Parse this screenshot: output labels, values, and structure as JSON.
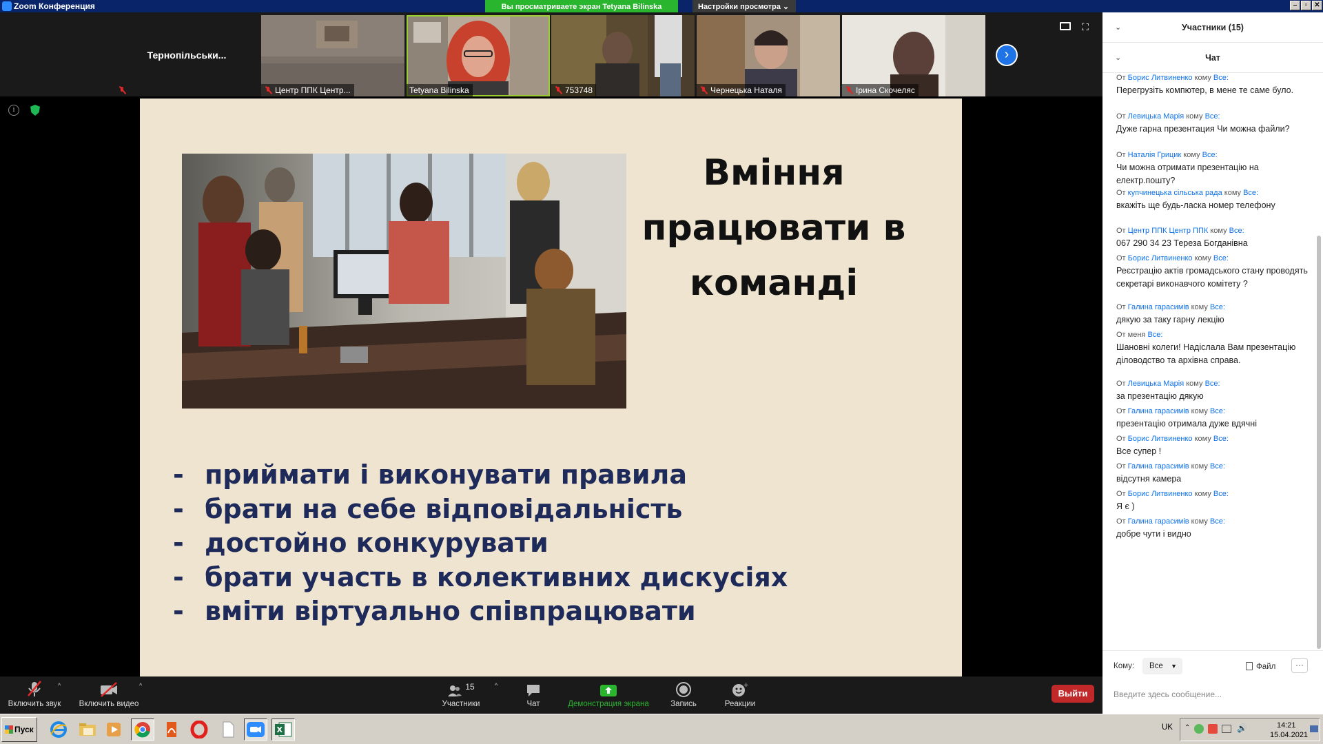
{
  "window": {
    "title": "Zoom Конференция",
    "share_banner": "Вы просматриваете экран Tetyana Bilinska",
    "view_options": "Настройки просмотра ⌄"
  },
  "gallery": {
    "tiles": [
      {
        "name": "Тернопільськи...",
        "muted": true,
        "video": false
      },
      {
        "name": "Центр ППК Центр...",
        "muted": true,
        "video": true
      },
      {
        "name": "Tetyana Bilinska",
        "muted": false,
        "video": true,
        "active_speaker": true
      },
      {
        "name": "753748",
        "muted": true,
        "video": true
      },
      {
        "name": "Чернецька Наталя",
        "muted": true,
        "video": true
      },
      {
        "name": "Ірина Скочеляс",
        "muted": true,
        "video": true
      }
    ]
  },
  "slide": {
    "title_lines": [
      "Вміння",
      "працювати в",
      "команді"
    ],
    "bullets": [
      "приймати і виконувати правила",
      "брати на себе відповідальність",
      "достойно конкурувати",
      "брати участь в колективних дискусіях",
      "вміти віртуально співпрацювати"
    ]
  },
  "toolbar": {
    "audio_label": "Включить звук",
    "video_label": "Включить видео",
    "participants_count": "15",
    "participants_label": "Участники",
    "chat_label": "Чат",
    "share_label": "Демонстрация экрана",
    "record_label": "Запись",
    "reactions_label": "Реакции",
    "leave_label": "Выйти"
  },
  "panel": {
    "participants_header": "Участники (15)",
    "chat_header": "Чат",
    "from_word": "От",
    "to_word": "кому",
    "all_word": "Все:",
    "messages": [
      {
        "from": "Борис Литвиненко",
        "text": "Перегрузіть компютер, в мене те саме було."
      },
      {
        "from": "Левицька Марія",
        "text": "Дуже гарна презентация Чи можна файли?"
      },
      {
        "from": "Наталія Грицик",
        "text": "Чи можна отримати презентацію на електр.пошту?"
      },
      {
        "from": "купчинецька сільська рада",
        "text": "вкажіть ще будь-ласка номер телефону"
      },
      {
        "from": "Центр ППК Центр ППК",
        "text": "067 290 34 23 Тереза Богданівна"
      },
      {
        "from": "Борис Литвиненко",
        "text": "Реєстрацію актів громадського стану проводять секретарі виконавчого комітету ?"
      },
      {
        "from": "Галина гарасимів",
        "text": "дякую за таку гарну лекцію"
      },
      {
        "from": "меня",
        "text": "Шановні колеги! Надіслала Вам презентацію діловодство та архівна справа.",
        "self": true
      },
      {
        "from": "Левицька Марія",
        "text": "за презентацію дякую"
      },
      {
        "from": "Галина гарасимів",
        "text": "презентацію отримала дуже вдячні"
      },
      {
        "from": "Борис Литвиненко",
        "text": "Все супер !"
      },
      {
        "from": "Галина гарасимів",
        "text": "відсутня камера"
      },
      {
        "from": "Борис Литвиненко",
        "text": "Я є )"
      },
      {
        "from": "Галина гарасимів",
        "text": "добре чути і видно"
      }
    ],
    "to_label": "Кому:",
    "to_value": "Все",
    "file_label": "Файл",
    "more_label": "···",
    "input_placeholder": "Введите здесь сообщение..."
  },
  "taskbar": {
    "start_label": "Пуск",
    "lang": "UK",
    "time": "14:21",
    "date": "15.04.2021",
    "apps": [
      "ie-icon",
      "explorer-folder-icon",
      "media-player-icon",
      "chrome-icon",
      "acrobat-icon",
      "opera-icon",
      "blank-document-icon",
      "zoom-icon",
      "excel-icon"
    ]
  },
  "colors": {
    "accent_blue": "#0e71eb",
    "share_green": "#2ab52e",
    "leave_red": "#c0282a",
    "slide_bg": "#eee4d0",
    "bullet_navy": "#1e2a5a"
  }
}
